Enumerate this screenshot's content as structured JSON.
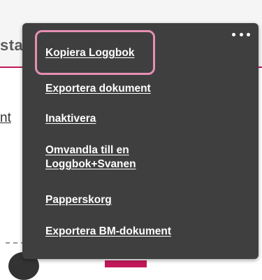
{
  "background": {
    "fragment_top": "sta",
    "fragment_link": "nt"
  },
  "menu": {
    "more_icon": "more-horizontal-icon",
    "items": [
      {
        "label": "Kopiera Loggbok",
        "focused": true
      },
      {
        "label": "Exportera dokument"
      },
      {
        "label": "Inaktivera"
      },
      {
        "label": "Omvandla till en Loggbok+Svanen"
      },
      {
        "label": "Papperskorg"
      },
      {
        "label": "Exportera BM-dokument"
      }
    ]
  },
  "colors": {
    "menu_bg": "#3f3f3f",
    "menu_text": "#ffffff",
    "focus_ring": "#e58fb3",
    "accent": "#c2185b"
  }
}
